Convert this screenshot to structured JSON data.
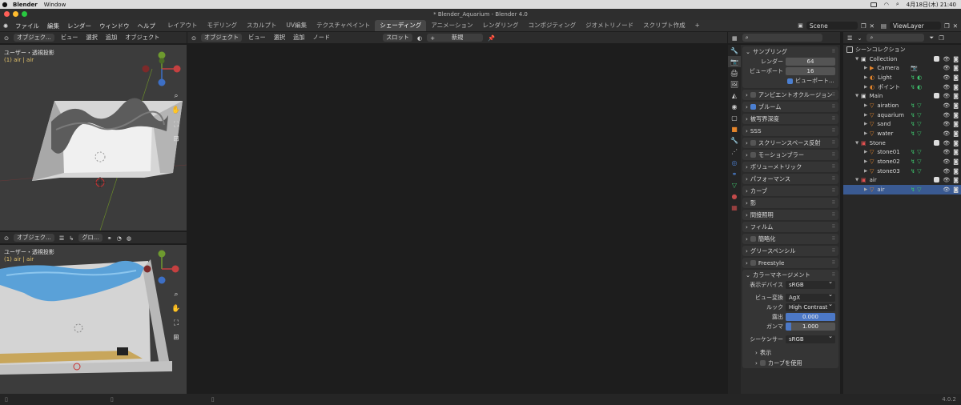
{
  "macbar": {
    "app": "Blender",
    "menus": [
      "Window"
    ],
    "clock": "4月18日(木) 21:40"
  },
  "window_title": "* Blender_Aquarium - Blender 4.0",
  "topbar": {
    "menus": [
      "ファイル",
      "編集",
      "レンダー",
      "ウィンドウ",
      "ヘルプ"
    ],
    "workspaces": [
      "レイアウト",
      "モデリング",
      "スカルプト",
      "UV編集",
      "テクスチャペイント",
      "シェーディング",
      "アニメーション",
      "レンダリング",
      "コンポジティング",
      "ジオメトリノード",
      "スクリプト作成"
    ],
    "active_workspace": "シェーディング",
    "add_tab": "+",
    "scene": "Scene",
    "view_layer": "ViewLayer"
  },
  "viewport_top": {
    "header": {
      "mode": "オブジェク...",
      "menus": [
        "ビュー",
        "選択",
        "追加",
        "オブジェクト"
      ]
    },
    "label": "ユーザー・透視投影",
    "sublabel": "(1) air | air"
  },
  "viewport_bottom": {
    "header": {
      "mode": "オブジェク...",
      "transform": "グロ..."
    },
    "label": "ユーザー・透視投影",
    "sublabel": "(1) air | air"
  },
  "shader_editor": {
    "header": {
      "mode": "オブジェクト",
      "menus": [
        "ビュー",
        "選択",
        "追加",
        "ノード"
      ],
      "slot": "スロット",
      "new_button": "新規",
      "new_plus": "+"
    }
  },
  "properties": {
    "sampling": {
      "title": "サンプリング",
      "render_label": "レンダー",
      "render_value": "64",
      "viewport_label": "ビューポート",
      "viewport_value": "16",
      "denoise_label": "ビューポート..."
    },
    "panels": [
      {
        "label": "アンビエントオクルージョン",
        "checkbox": true,
        "checked": false
      },
      {
        "label": "ブルーム",
        "checkbox": true,
        "checked": true
      },
      {
        "label": "被写界深度",
        "checkbox": false,
        "checked": false
      },
      {
        "label": "SSS",
        "checkbox": false,
        "checked": false
      },
      {
        "label": "スクリーンスペース反射",
        "checkbox": true,
        "checked": false
      },
      {
        "label": "モーションブラー",
        "checkbox": true,
        "checked": false
      },
      {
        "label": "ボリューメトリック",
        "checkbox": false,
        "checked": false
      },
      {
        "label": "パフォーマンス",
        "checkbox": false,
        "checked": false
      },
      {
        "label": "カーブ",
        "checkbox": false,
        "checked": false
      },
      {
        "label": "影",
        "checkbox": false,
        "checked": false
      },
      {
        "label": "間接照明",
        "checkbox": false,
        "checked": false
      },
      {
        "label": "フィルム",
        "checkbox": false,
        "checked": false
      },
      {
        "label": "簡略化",
        "checkbox": true,
        "checked": false
      },
      {
        "label": "グリースペンシル",
        "checkbox": false,
        "checked": false
      },
      {
        "label": "Freestyle",
        "checkbox": true,
        "checked": false
      }
    ],
    "color_management": {
      "title": "カラーマネージメント",
      "display_label": "表示デバイス",
      "display_value": "sRGB",
      "view_label": "ビュー変換",
      "view_value": "AgX",
      "look_label": "ルック",
      "look_value": "High Contrast",
      "exposure_label": "露出",
      "exposure_value": "0.000",
      "exposure_fraction": 1.0,
      "gamma_label": "ガンマ",
      "gamma_value": "1.000",
      "gamma_fraction": 0.12,
      "sequencer_label": "シーケンサー",
      "sequencer_value": "sRGB",
      "display_sub": "表示",
      "curves_sub": "カーブを使用"
    }
  },
  "outliner": {
    "root": "シーンコレクション",
    "rows": [
      {
        "name": "Collection",
        "depth": 1,
        "kind": "collection",
        "open": true
      },
      {
        "name": "Camera",
        "depth": 2,
        "kind": "camera"
      },
      {
        "name": "Light",
        "depth": 2,
        "kind": "light"
      },
      {
        "name": "ポイント",
        "depth": 2,
        "kind": "light"
      },
      {
        "name": "Main",
        "depth": 1,
        "kind": "collection",
        "open": true
      },
      {
        "name": "airation",
        "depth": 2,
        "kind": "mesh"
      },
      {
        "name": "aquarium",
        "depth": 2,
        "kind": "mesh"
      },
      {
        "name": "sand",
        "depth": 2,
        "kind": "mesh"
      },
      {
        "name": "water",
        "depth": 2,
        "kind": "mesh"
      },
      {
        "name": "Stone",
        "depth": 1,
        "kind": "collection-red",
        "open": true
      },
      {
        "name": "stone01",
        "depth": 2,
        "kind": "mesh"
      },
      {
        "name": "stone02",
        "depth": 2,
        "kind": "mesh"
      },
      {
        "name": "stone03",
        "depth": 2,
        "kind": "mesh"
      },
      {
        "name": "air",
        "depth": 1,
        "kind": "collection-red",
        "open": true
      },
      {
        "name": "air",
        "depth": 2,
        "kind": "mesh",
        "selected": true
      }
    ]
  },
  "status": {
    "version": "4.0.2"
  },
  "colors": {
    "accent": "#4b7fd1",
    "selection": "#3a5a92",
    "object": "#e5852b"
  }
}
